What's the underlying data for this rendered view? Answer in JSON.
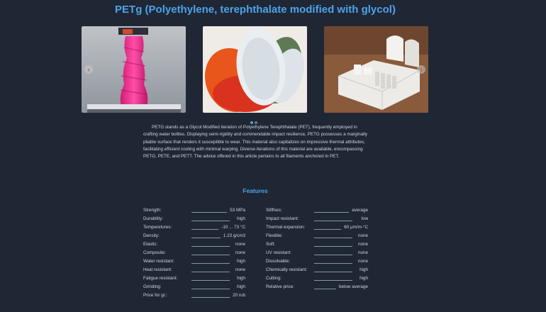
{
  "page_title": "PETg (Polyethylene, terephthalate modified with glycol)",
  "carousel": {
    "slides": [
      {
        "icon": "pink-vase-print-image"
      },
      {
        "icon": "colored-plates-image"
      },
      {
        "icon": "white-print-model-image"
      }
    ],
    "prev_icon": "‹",
    "next_icon": "›",
    "active_dot": 0
  },
  "description": "PETG stands as a Glycol Modified iteration of Polyethylene Terephthalate (PET), frequently employed in crafting water bottles. Displaying semi-rigidity and commendable impact resilience, PETG possesses a marginally pliable surface that renders it susceptible to wear. This material also capitalizes on impressive thermal attributes, facilitating efficient cooling with minimal warping. Diverse iterations of this material are available, encompassing PETG, PETE, and PETT. The advice offered in this article pertains to all filaments anchored in PET.",
  "features": {
    "title": "Features",
    "left": [
      {
        "label": "Strength:",
        "value": "53 MPa"
      },
      {
        "label": "Durability:",
        "value": "high"
      },
      {
        "label": "Temperetures:",
        "value": "-10 ... 73 °C"
      },
      {
        "label": "Density:",
        "value": "1.23 g/cm3"
      },
      {
        "label": "Elastic:",
        "value": "none"
      },
      {
        "label": "Composite:",
        "value": "none"
      },
      {
        "label": "Water resistant:",
        "value": "high"
      },
      {
        "label": "Heat resistant:",
        "value": "none"
      },
      {
        "label": "Fatigue resistant:",
        "value": "high"
      },
      {
        "label": "Grinding:",
        "value": "high"
      },
      {
        "label": "Price for gr.:",
        "value": "20 rub"
      }
    ],
    "right": [
      {
        "label": "Stiffnes:",
        "value": "average"
      },
      {
        "label": "Impact resistant:",
        "value": "low"
      },
      {
        "label": "Thermal expansion:",
        "value": "60 μm/m-°C"
      },
      {
        "label": "Flexible:",
        "value": "none"
      },
      {
        "label": "Soft:",
        "value": "none"
      },
      {
        "label": "UV resistant:",
        "value": "none"
      },
      {
        "label": "Dissolvable:",
        "value": "none"
      },
      {
        "label": "Chemically resistant:",
        "value": "high"
      },
      {
        "label": "Cutting:",
        "value": "high"
      },
      {
        "label": "Relative price:",
        "value": "below average"
      }
    ]
  },
  "colors": {
    "background": "#1f2735",
    "accent": "#4da3e8"
  }
}
